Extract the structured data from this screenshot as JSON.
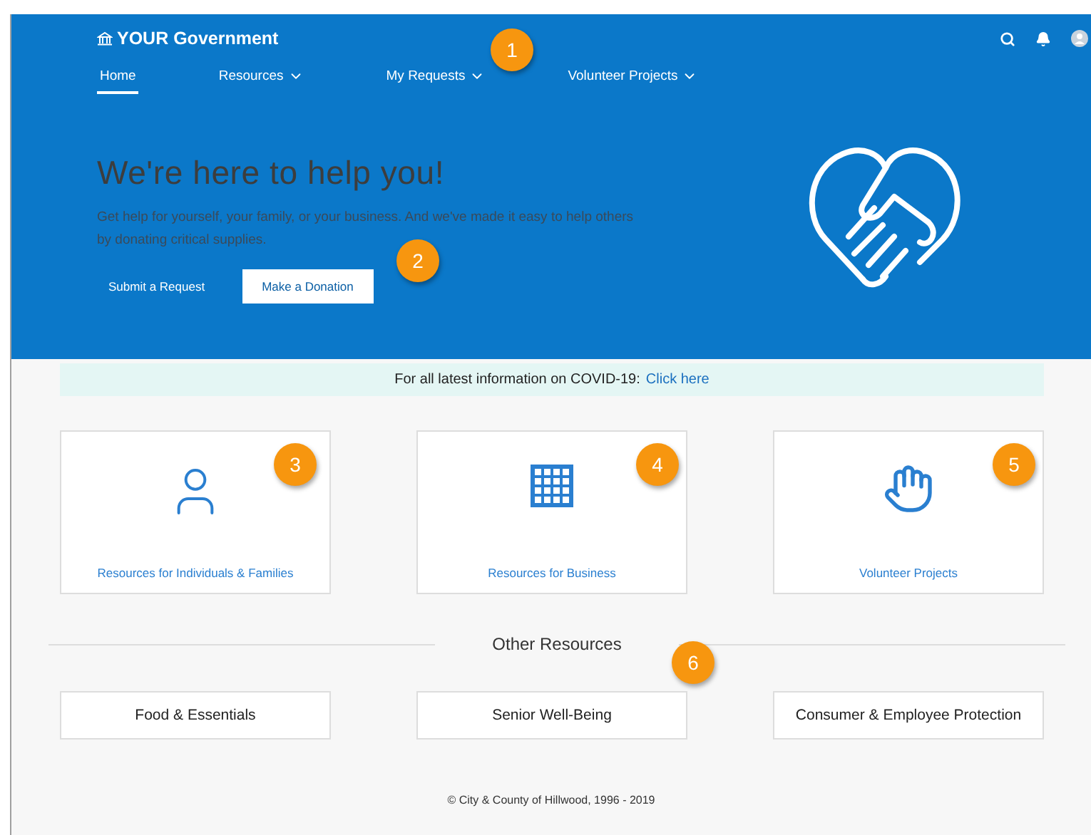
{
  "header": {
    "logo": "YOUR Government",
    "nav": [
      {
        "label": "Home",
        "selected": true,
        "dropdown": false
      },
      {
        "label": "Resources",
        "selected": false,
        "dropdown": true
      },
      {
        "label": "My Requests",
        "selected": false,
        "dropdown": true
      },
      {
        "label": "Volunteer Projects",
        "selected": false,
        "dropdown": true
      }
    ]
  },
  "hero": {
    "title": "We're here to help you!",
    "description": "Get help for yourself, your family, or your business. And we've made it easy to help others by donating critical supplies.",
    "buttons": [
      {
        "label": "Submit a Request",
        "kind": "link"
      },
      {
        "label": "Make a Donation",
        "kind": "solid"
      }
    ]
  },
  "notice": {
    "text": "For all latest information on COVID-19:",
    "link": "Click here"
  },
  "resource_cards": [
    {
      "label": "Resources for Individuals & Families",
      "kind": "person"
    },
    {
      "label": "Resources for Business",
      "kind": "building"
    },
    {
      "label": "Volunteer Projects",
      "kind": "hand"
    }
  ],
  "other_resources": {
    "title": "Other Resources",
    "items": [
      "Food & Essentials",
      "Senior Well-Being",
      "Consumer & Employee Protection"
    ]
  },
  "footer": "© City & County of Hillwood, 1996 - 2019",
  "callouts": [
    "1",
    "2",
    "3",
    "4",
    "5",
    "6"
  ]
}
